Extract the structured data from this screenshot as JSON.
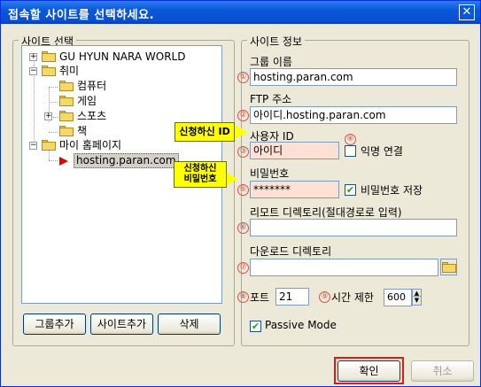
{
  "window": {
    "title": "접속할 사이트를 선택하세요.",
    "close_glyph": "✕"
  },
  "site_select": {
    "group_label": "사이트 선택",
    "tree": {
      "item1": "GU HYUN NARA WORLD",
      "item2": "취미",
      "item2_children": [
        "컴퓨터",
        "게임",
        "스포츠",
        "책"
      ],
      "item3": "마이 홈페이지",
      "item3_child": "hosting.paran.com"
    },
    "buttons": {
      "add_group": "그룹추가",
      "add_site": "사이트추가",
      "delete": "삭제"
    }
  },
  "site_info": {
    "group_label": "사이트 정보",
    "markers": [
      "①",
      "②",
      "③",
      "④",
      "⑤",
      "⑥",
      "⑦",
      "⑧",
      "⑨"
    ],
    "group_name_label": "그룹 이름",
    "group_name_value": "hosting.paran.com",
    "ftp_label": "FTP 주소",
    "ftp_value": "아이디.hosting.paran.com",
    "user_id_label": "사용자 ID",
    "user_id_value": "아이디",
    "anonymous_label": "익명 연결",
    "anonymous_checked": false,
    "password_label": "비밀번호",
    "password_value": "*******",
    "save_password_label": "비밀번호 저장",
    "save_password_checked": true,
    "remote_dir_label": "리모트 디렉토리(절대경로로 입력)",
    "remote_dir_value": "",
    "download_dir_label": "다운로드 디렉토리",
    "download_dir_value": "",
    "port_label": "포트",
    "port_value": "21",
    "timeout_label": "시간 제한",
    "timeout_value": "600",
    "passive_label": "Passive Mode",
    "passive_checked": true,
    "check_glyph": "✔"
  },
  "callouts": {
    "id_note": "신청하신 ID",
    "pw_note_line1": "신청하신",
    "pw_note_line2": "비밀번호"
  },
  "footer": {
    "ok_label": "확인",
    "cancel_label": "취소"
  },
  "colors": {
    "title_bar": "#0a58d9",
    "highlight": "#e01818",
    "callout": "#ffff00",
    "marker": "#e0504a"
  }
}
